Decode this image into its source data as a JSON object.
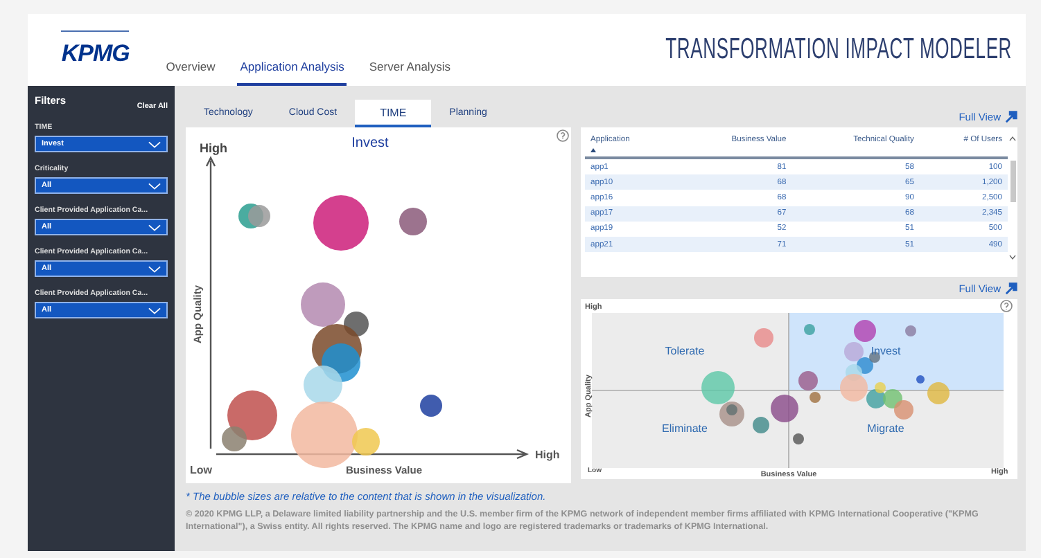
{
  "logo": "KPMG",
  "nav": [
    {
      "label": "Overview",
      "selected": false
    },
    {
      "label": "Application Analysis",
      "selected": true
    },
    {
      "label": "Server Analysis",
      "selected": false
    }
  ],
  "app_title": "TRANSFORMATION IMPACT MODELER",
  "filters": {
    "title": "Filters",
    "clear": "Clear All",
    "items": [
      {
        "label": "TIME",
        "value": "Invest"
      },
      {
        "label": "Criticality",
        "value": "All"
      },
      {
        "label": "Client Provided Application Ca...",
        "value": "All"
      },
      {
        "label": "Client Provided Application Ca...",
        "value": "All"
      },
      {
        "label": "Client Provided Application Ca...",
        "value": "All"
      }
    ]
  },
  "tabs": [
    {
      "label": "Technology",
      "selected": false
    },
    {
      "label": "Cloud Cost",
      "selected": false
    },
    {
      "label": "TIME",
      "selected": true
    },
    {
      "label": "Planning",
      "selected": false
    }
  ],
  "bubble_chart": {
    "title": "Invest",
    "y_high": "High",
    "y_label": "App Quality",
    "x_low": "Low",
    "x_high": "High",
    "x_label": "Business Value"
  },
  "table_full_view": "Full View",
  "table": {
    "columns": [
      {
        "label": "Application",
        "sorted": true
      },
      {
        "label": "Business Value",
        "sorted": false
      },
      {
        "label": "Technical Quality",
        "sorted": false
      },
      {
        "label": "# Of Users",
        "sorted": false
      }
    ],
    "rows": [
      [
        "app1",
        "81",
        "58",
        "100"
      ],
      [
        "app10",
        "68",
        "65",
        "1,200"
      ],
      [
        "app16",
        "68",
        "90",
        "2,500"
      ],
      [
        "app17",
        "67",
        "68",
        "2,345"
      ],
      [
        "app19",
        "52",
        "51",
        "500"
      ],
      [
        "app21",
        "71",
        "51",
        "490"
      ]
    ]
  },
  "quadrant_full_view": "Full View",
  "quadrant_chart": {
    "y_high": "High",
    "y_label": "App Quality",
    "x_low": "Low",
    "x_label": "Business Value",
    "x_high": "High",
    "quadrants": [
      {
        "label": "Tolerate",
        "selected": false
      },
      {
        "label": "Invest",
        "selected": true
      },
      {
        "label": "Eliminate",
        "selected": false
      },
      {
        "label": "Migrate",
        "selected": false
      }
    ]
  },
  "footnote": "* The bubble sizes are relative to the content that is shown in the visualization.",
  "copyright": "© 2020 KPMG LLP, a Delaware limited liability partnership and the U.S. member firm of the KPMG network of independent member firms affiliated with KPMG International Cooperative (\"KPMG International\"), a Swiss entity. All rights reserved. The KPMG name and logo are registered trademarks or trademarks of KPMG International."
}
